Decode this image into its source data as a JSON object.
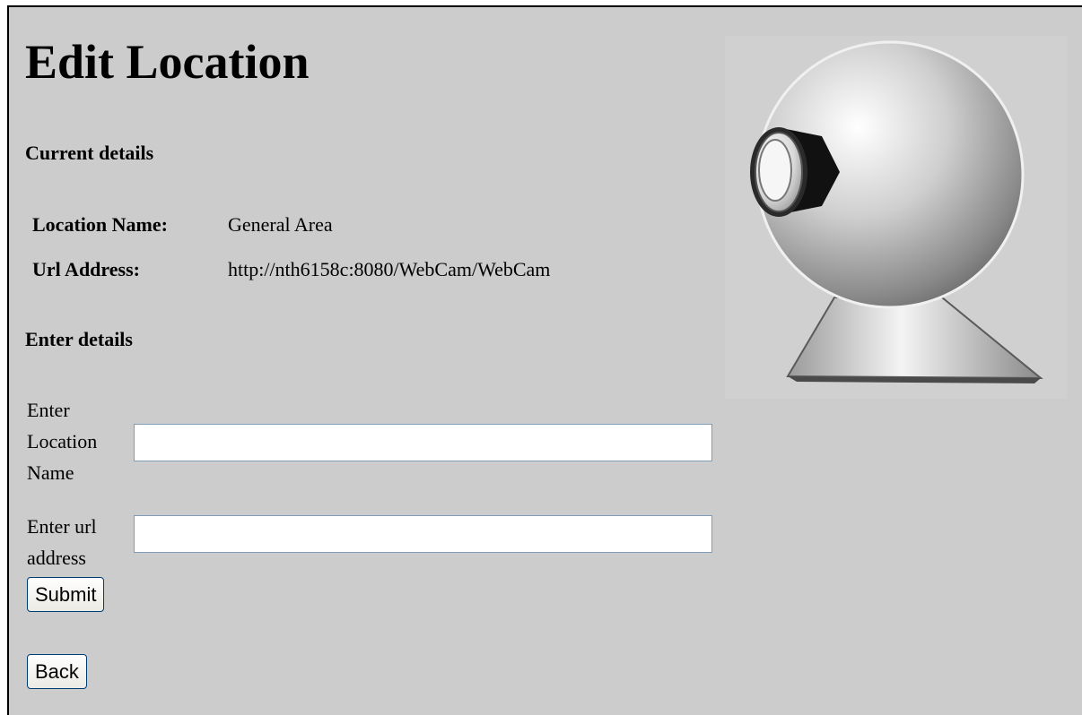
{
  "page": {
    "title": "Edit Location"
  },
  "current_details": {
    "heading": "Current details",
    "location_name_label": "Location Name:",
    "location_name_value": "General Area",
    "url_address_label": "Url Address:",
    "url_address_value": "http://nth6158c:8080/WebCam/WebCam"
  },
  "enter_details": {
    "heading": "Enter details",
    "location_name_label_lines": [
      "Enter",
      "Location",
      "Name"
    ],
    "location_name_input_value": "",
    "url_label_lines": [
      "Enter url",
      "address"
    ],
    "url_input_value": "",
    "submit_label": "Submit"
  },
  "navigation": {
    "back_label": "Back"
  },
  "colors": {
    "page_background": "#cccccc",
    "input_border": "#7f9db9",
    "button_border": "#003c74"
  }
}
